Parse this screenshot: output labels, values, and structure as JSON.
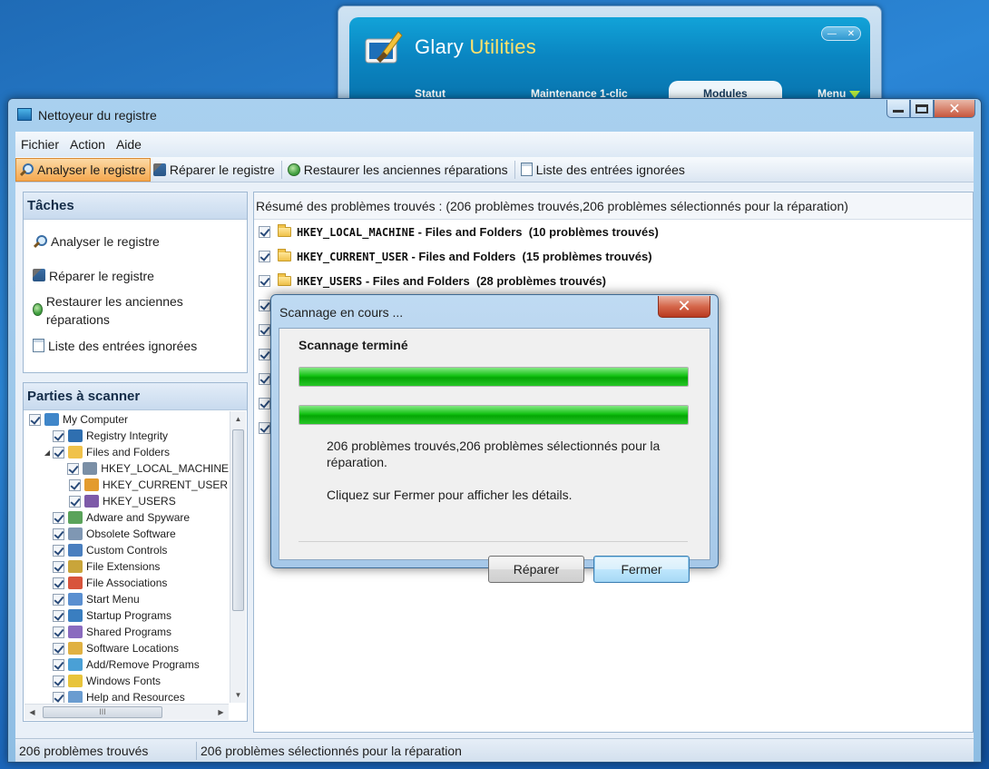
{
  "background_app": {
    "title_part1": "Glary ",
    "title_part2": "Utilities",
    "tabs": [
      {
        "label": "Statut"
      },
      {
        "label": "Maintenance 1-clic"
      },
      {
        "label": "Modules"
      },
      {
        "label": "Menu"
      }
    ],
    "accent_color": "#ffe26b"
  },
  "window": {
    "title": "Nettoyeur du registre"
  },
  "menubar": {
    "items": [
      "Fichier",
      "Action",
      "Aide"
    ]
  },
  "toolbar": {
    "buttons": [
      {
        "label": "Analyser le registre",
        "icon": "magnifier-icon"
      },
      {
        "label": "Réparer le registre",
        "icon": "repair-icon"
      },
      {
        "label": "Restaurer les anciennes réparations",
        "icon": "restore-icon"
      },
      {
        "label": "Liste des entrées ignorées",
        "icon": "list-icon"
      }
    ],
    "active_color": "#f5a84f"
  },
  "tasks": {
    "header": "Tâches",
    "items": [
      {
        "label": "Analyser le registre"
      },
      {
        "label": "Réparer le registre"
      },
      {
        "label": "Restaurer les anciennes réparations"
      },
      {
        "label": "Liste des entrées ignorées"
      }
    ]
  },
  "scan_tree": {
    "header": "Parties à scanner",
    "nodes": [
      {
        "label": "My Computer",
        "level": 0
      },
      {
        "label": "Registry Integrity",
        "level": 1
      },
      {
        "label": "Files and Folders",
        "level": 1
      },
      {
        "label": "HKEY_LOCAL_MACHINE",
        "level": 2
      },
      {
        "label": "HKEY_CURRENT_USER",
        "level": 2
      },
      {
        "label": "HKEY_USERS",
        "level": 2
      },
      {
        "label": "Adware and Spyware",
        "level": 1
      },
      {
        "label": "Obsolete Software",
        "level": 1
      },
      {
        "label": "Custom Controls",
        "level": 1
      },
      {
        "label": "File Extensions",
        "level": 1
      },
      {
        "label": "File Associations",
        "level": 1
      },
      {
        "label": "Start Menu",
        "level": 1
      },
      {
        "label": "Startup Programs",
        "level": 1
      },
      {
        "label": "Shared Programs",
        "level": 1
      },
      {
        "label": "Software Locations",
        "level": 1
      },
      {
        "label": "Add/Remove Programs",
        "level": 1
      },
      {
        "label": "Windows Fonts",
        "level": 1
      },
      {
        "label": "Help and Resources",
        "level": 1
      }
    ],
    "hscroll_grip": "III"
  },
  "results": {
    "summary": "Résumé des problèmes trouvés : (206 problèmes trouvés,206 problèmes sélectionnés pour la réparation)",
    "rows": [
      {
        "key": "HKEY_LOCAL_MACHINE",
        "text": " - Files and Folders  (10 problèmes trouvés)"
      },
      {
        "key": "HKEY_CURRENT_USER",
        "text": " - Files and Folders  (15 problèmes trouvés)"
      },
      {
        "key": "HKEY_USERS",
        "text": " - Files and Folders  (28 problèmes trouvés)"
      }
    ]
  },
  "dialog": {
    "title": "Scannage en cours ...",
    "heading": "Scannage terminé",
    "progress_1": 1.0,
    "progress_2": 1.0,
    "message_1": "206 problèmes trouvés,206 problèmes sélectionnés pour la réparation.",
    "message_2": "Cliquez sur Fermer pour afficher les détails.",
    "repair_label": "Réparer",
    "close_label": "Fermer",
    "progress_color": "#12c212"
  },
  "statusbar": {
    "found": "206 problèmes trouvés",
    "selected": "206 problèmes sélectionnés pour la réparation"
  }
}
